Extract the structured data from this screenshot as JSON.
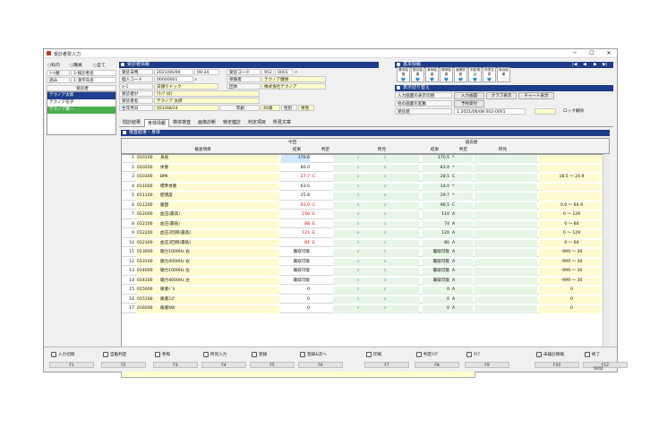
{
  "window": {
    "title": "受診者票入力",
    "controls": [
      "─",
      "☐",
      "✕"
    ]
  },
  "left": {
    "radios": [
      "○科内",
      "○職員",
      "○全て"
    ],
    "sort_label": "ｿｰﾄ順",
    "sort_value": "2:検診者名",
    "read_label": "読み",
    "read_value": "1:漢字氏名",
    "list_header": "受診者",
    "items": [
      "テクノア太郎",
      "テクノア花子",
      "テクノア機一"
    ]
  },
  "patient": {
    "section": "受診者情報",
    "date_label": "受診日時",
    "date_value": "2021/06/09",
    "time_value": "09:34",
    "code_label": "受診コード",
    "code_prefix": "952",
    "code_value": "0001",
    "id_label": "個人コード",
    "id_value": "00000001",
    "ins_label": "保険者",
    "ins_value": "テクノア健保",
    "course_label": "ｺｰｽ",
    "course_value": "日帰りドック",
    "org_label": "団体",
    "org_value": "株式会社テクノア",
    "kana_label": "受診者ｶﾅ",
    "kana_value": "ﾃｸﾉｱ ﾀﾛｳ",
    "name_label": "受診者名",
    "name_value": "テクノア 太郎",
    "birth_label": "生年月日",
    "birth_value": "S51/08/24",
    "age_label": "年齢",
    "age_value": "40歳",
    "sex_label": "性別",
    "sex_value": "男性"
  },
  "basic": {
    "section": "基本情報",
    "toolbar": [
      "基本結果",
      "既往結果",
      "身体結果",
      "検体結果",
      "画像診断",
      "判定項目",
      "所見文章",
      "総合結果"
    ],
    "nav": [
      "|◀",
      "◀",
      "▶",
      "▶|"
    ]
  },
  "display": {
    "section": "表示切り替え",
    "row1_label": "入力画面の表示切替",
    "row1_btn1": "入力画面",
    "row1_btn2": "グラフ表示",
    "row1_btn3": "チャート表示",
    "row2_label": "他の画面を起動",
    "row2_btn": "予約受付",
    "row3_label": "受診歴",
    "row3_value": "1:2021/06/08 002-0001",
    "lock_label": "ロック解除"
  },
  "tabs": [
    "問診結果",
    "身体情報",
    "検体検査",
    "画像診断",
    "特定健診",
    "判定項目",
    "所見文章"
  ],
  "active_tab": "身体情報",
  "grid_section": "検査結果・身体",
  "grid_headers": {
    "item": "検査項目",
    "current": "今回",
    "previous": "過去歴",
    "result": "結果",
    "judge": "判定",
    "finding": "所見",
    "presult": "結果",
    "pjudge": "判定",
    "pfinding": "所見"
  },
  "rows": [
    {
      "no": "1",
      "code": "010100",
      "name": "身長",
      "res": "170.6",
      "jud": "",
      "pres": "170.5",
      "pj": "*",
      "range": ""
    },
    {
      "no": "2",
      "code": "010200",
      "name": "体重",
      "res": "80.0",
      "jud": "",
      "pres": "83.0",
      "pj": "*",
      "range": ""
    },
    {
      "no": "3",
      "code": "010300",
      "name": "BMI",
      "res": "27.7",
      "jud": "C",
      "pres": "28.5",
      "pj": "C",
      "range": "18.5  ～  24.9",
      "red": true
    },
    {
      "no": "4",
      "code": "011000",
      "name": "標準体重",
      "res": "63.6",
      "jud": "",
      "pres": "14.0",
      "pj": "*",
      "range": ""
    },
    {
      "no": "5",
      "code": "011100",
      "name": "肥満度",
      "res": "25.8",
      "jud": "",
      "pres": "29.7",
      "pj": "*",
      "range": ""
    },
    {
      "no": "6",
      "code": "011200",
      "name": "腹囲",
      "res": "91.0",
      "jud": "C",
      "pres": "96.5",
      "pj": "C",
      "range": "0.0  ～  84.9",
      "red": true
    },
    {
      "no": "7",
      "code": "012000",
      "name": "血圧(最高)",
      "res": "150",
      "jud": "E",
      "pres": "110",
      "pj": "A",
      "range": "0  ～  129",
      "red": true
    },
    {
      "no": "8",
      "code": "012100",
      "name": "血圧(最低)",
      "res": "88",
      "jud": "E",
      "pres": "74",
      "pj": "A",
      "range": "0  ～  84",
      "red": true
    },
    {
      "no": "9",
      "code": "012200",
      "name": "血圧2回目(最高)",
      "res": "121",
      "jud": "E",
      "pres": "120",
      "pj": "A",
      "range": "0  ～  129",
      "red": true
    },
    {
      "no": "10",
      "code": "012300",
      "name": "血圧2回目(最低)",
      "res": "81",
      "jud": "E",
      "pres": "80",
      "pj": "A",
      "range": "0  ～  84",
      "red": true
    },
    {
      "no": "11",
      "code": "013000",
      "name": "聴力1000Hz 右",
      "res": "聴取可能",
      "jud": "",
      "pres": "聴取可能",
      "pj": "A",
      "range": "-999  ～  30"
    },
    {
      "no": "12",
      "code": "013100",
      "name": "聴力4000Hz 右",
      "res": "聴取可能",
      "jud": "",
      "pres": "聴取可能",
      "pj": "A",
      "range": "-999  ～  30"
    },
    {
      "no": "13",
      "code": "014000",
      "name": "聴力1000Hz 左",
      "res": "聴取可能",
      "jud": "",
      "pres": "聴取可能",
      "pj": "A",
      "range": "-999  ～  30"
    },
    {
      "no": "14",
      "code": "014100",
      "name": "聴力4000Hz 左",
      "res": "聴取可能",
      "jud": "",
      "pres": "聴取可能",
      "pj": "A",
      "range": "-999  ～  30"
    },
    {
      "no": "15",
      "code": "015000",
      "name": "眼底ﾍﾞﾙ",
      "res": "0",
      "jud": "",
      "pres": "0",
      "pj": "A",
      "range": "0"
    },
    {
      "no": "16",
      "code": "015100",
      "name": "眼底ｽｺｱ",
      "res": "0",
      "jud": "",
      "pres": "0",
      "pj": "A",
      "range": "0"
    },
    {
      "no": "17",
      "code": "016000",
      "name": "眼底KW",
      "res": "0",
      "jud": "",
      "pres": "0",
      "pj": "A",
      "range": "0"
    }
  ],
  "fkeys": [
    {
      "label": "入力切替",
      "key": "F1"
    },
    {
      "label": "自動判定",
      "key": "F2"
    },
    {
      "label": "参照",
      "key": "F3"
    },
    {
      "label": "所見入力",
      "key": "F4"
    },
    {
      "label": "登録",
      "key": "F5"
    },
    {
      "label": "登録&次へ",
      "key": "F6"
    },
    {
      "label": "印刷",
      "key": "F7"
    },
    {
      "label": "判定ｸﾘｱ",
      "key": "F8"
    },
    {
      "label": "ｸﾘｱ",
      "key": "F9"
    },
    {
      "label": "未検診情報",
      "key": "F10"
    },
    {
      "label": "終了",
      "key": "F12"
    }
  ],
  "version": "0202"
}
